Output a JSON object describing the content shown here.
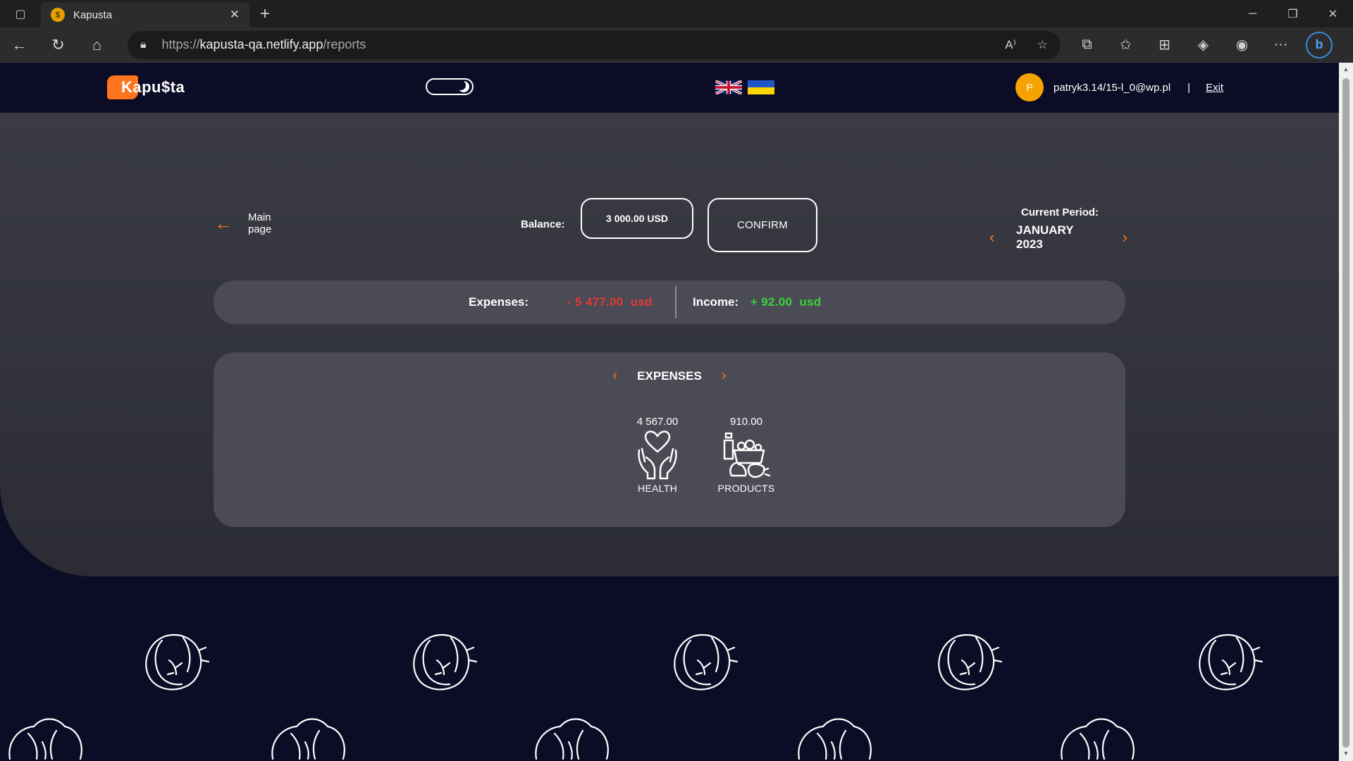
{
  "browser": {
    "tab_title": "Kapusta",
    "url_scheme": "https://",
    "url_host": "kapusta-qa.netlify.app",
    "url_path": "/reports"
  },
  "header": {
    "logo_text": "Kapu$ta",
    "user_initial": "P",
    "user_email": "patryk3.14/15-l_0@wp.pl",
    "separator": "|",
    "exit_label": "Exit"
  },
  "balance": {
    "back_label_1": "Main",
    "back_label_2": "page",
    "label": "Balance:",
    "value": "3 000.00 USD",
    "confirm_label": "CONFIRM"
  },
  "period": {
    "label": "Current Period:",
    "month": "JANUARY",
    "year": "2023"
  },
  "summary": {
    "expenses_label": "Expenses:",
    "expenses_value": "- 5 477.00  usd",
    "income_label": "Income:",
    "income_value": "+ 92.00  usd"
  },
  "categories": {
    "title": "EXPENSES",
    "items": [
      {
        "amount": "4 567.00",
        "name": "HEALTH",
        "icon": "health-icon"
      },
      {
        "amount": "910.00",
        "name": "PRODUCTS",
        "icon": "products-icon"
      }
    ]
  },
  "colors": {
    "accent": "#ff751d",
    "expense": "#e53935",
    "income": "#3dd13d",
    "panel": "#4a4b55",
    "background": "#0c0c26"
  }
}
